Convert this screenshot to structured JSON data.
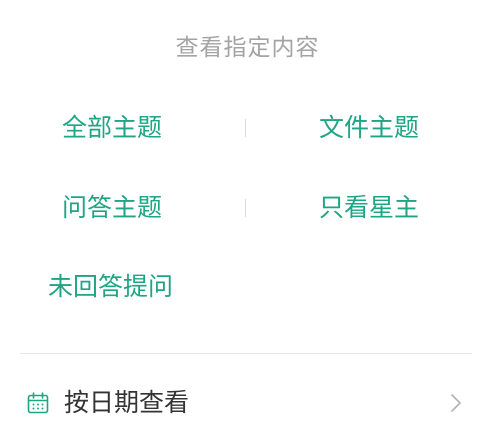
{
  "sheet": {
    "title": "查看指定内容"
  },
  "filters": [
    {
      "label": "全部主题"
    },
    {
      "label": "文件主题"
    },
    {
      "label": "问答主题"
    },
    {
      "label": "只看星主"
    },
    {
      "label": "未回答提问"
    }
  ],
  "date_filter": {
    "label": "按日期查看",
    "icon": "calendar-icon",
    "trailing_icon": "chevron-right-icon"
  },
  "colors": {
    "accent": "#1fa584",
    "title_gray": "#a3a3a3",
    "text_dark": "#333333",
    "divider": "#e8e8e8"
  }
}
